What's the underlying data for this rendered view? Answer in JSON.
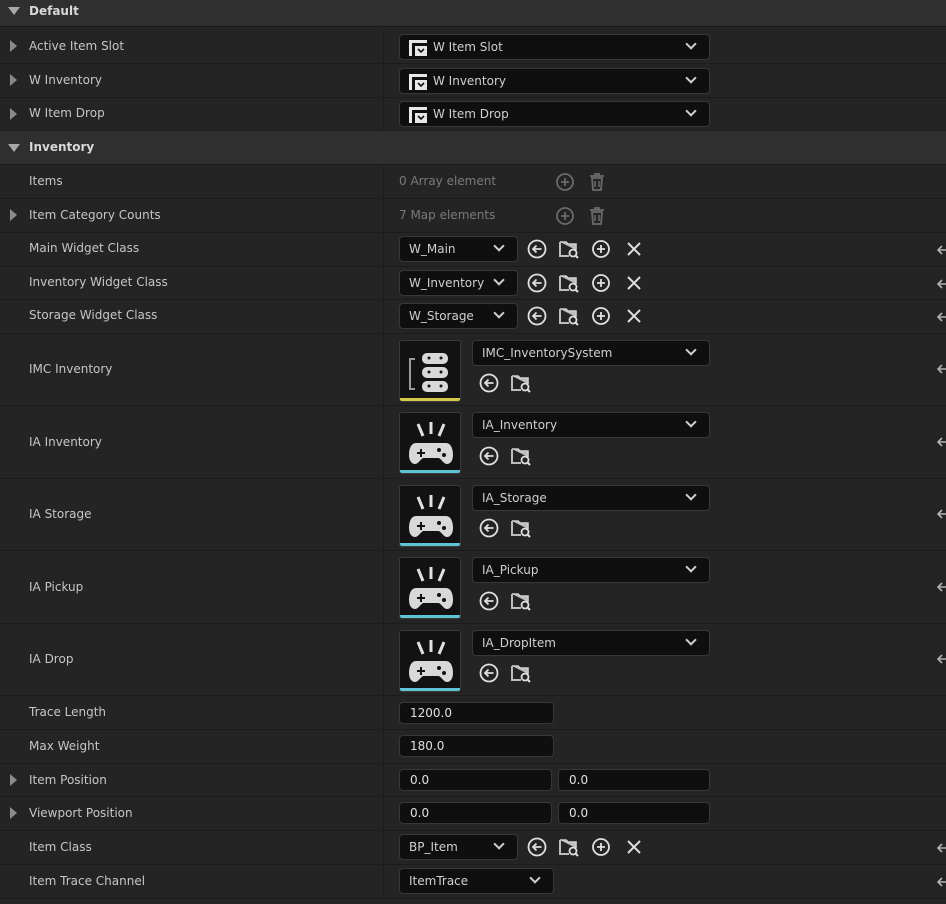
{
  "categories": {
    "default": "Default",
    "inventory": "Inventory"
  },
  "default_props": {
    "active_item_slot": {
      "label": "Active Item Slot",
      "value": "W Item Slot"
    },
    "w_inventory": {
      "label": "W Inventory",
      "value": "W Inventory"
    },
    "w_item_drop": {
      "label": "W Item Drop",
      "value": "W Item Drop"
    }
  },
  "items": {
    "label": "Items",
    "summary": "0 Array element"
  },
  "item_category_counts": {
    "label": "Item Category Counts",
    "summary": "7 Map elements"
  },
  "main_widget_class": {
    "label": "Main Widget Class",
    "value": "W_Main"
  },
  "inventory_widget_class": {
    "label": "Inventory Widget Class",
    "value": "W_Inventory"
  },
  "storage_widget_class": {
    "label": "Storage Widget Class",
    "value": "W_Storage"
  },
  "imc_inventory": {
    "label": "IMC Inventory",
    "value": "IMC_InventorySystem",
    "accent": "#d6c94a"
  },
  "ia_inventory": {
    "label": "IA Inventory",
    "value": "IA_Inventory",
    "accent": "#5fc3d6"
  },
  "ia_storage": {
    "label": "IA Storage",
    "value": "IA_Storage",
    "accent": "#5fc3d6"
  },
  "ia_pickup": {
    "label": "IA Pickup",
    "value": "IA_Pickup",
    "accent": "#5fc3d6"
  },
  "ia_drop": {
    "label": "IA Drop",
    "value": "IA_DropItem",
    "accent": "#5fc3d6"
  },
  "trace_length": {
    "label": "Trace Length",
    "value": "1200.0"
  },
  "max_weight": {
    "label": "Max Weight",
    "value": "180.0"
  },
  "item_position": {
    "label": "Item Position",
    "x": "0.0",
    "y": "0.0"
  },
  "viewport_position": {
    "label": "Viewport Position",
    "x": "0.0",
    "y": "0.0"
  },
  "item_class": {
    "label": "Item Class",
    "value": "BP_Item"
  },
  "item_trace_channel": {
    "label": "Item Trace Channel",
    "value": "ItemTrace"
  },
  "icons": {
    "use_selected": "arrow-left-circle-icon",
    "browse": "folder-search-icon",
    "add": "plus-circle-icon",
    "clear": "close-icon",
    "delete": "trash-icon",
    "widget": "widget-blueprint-icon",
    "reset": "reset-to-default-icon",
    "input_action": "gamepad-icon"
  }
}
